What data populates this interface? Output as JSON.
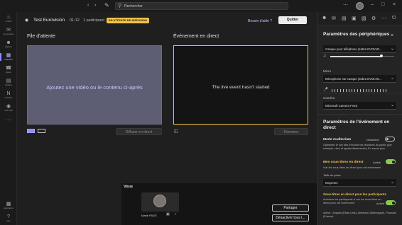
{
  "titlebar": {
    "search_placeholder": "Rechercher",
    "compose_icon": "compose-icon"
  },
  "rail": {
    "items": [
      {
        "label": "Activité",
        "icon": "bell-icon"
      },
      {
        "label": "Conversation",
        "icon": "chat-icon"
      },
      {
        "label": "Équipes",
        "icon": "teams-icon"
      },
      {
        "label": "Calendrier",
        "icon": "calendar-icon"
      },
      {
        "label": "Appels",
        "icon": "phone-icon"
      },
      {
        "label": "Fichiers",
        "icon": "file-icon"
      },
      {
        "label": "OneNote",
        "icon": "onenote-icon"
      },
      {
        "label": "Visit CRM",
        "icon": "crm-icon"
      },
      {
        "label": "Applications",
        "icon": "apps-icon"
      },
      {
        "label": "Aide",
        "icon": "help-icon"
      }
    ],
    "active_index": 3
  },
  "header": {
    "title": "Test Eurovision",
    "elapsed": "01:12",
    "participants": "1 participant",
    "badge": "EN ATTENTE DE DIFFUSION",
    "help_link": "Besoin d'aide ?",
    "quit_label": "Quitter"
  },
  "queue": {
    "title": "File d'attente",
    "message": "Ajoutez une vidéo ou le contenu ci-après",
    "button": "Diffuser en direct"
  },
  "live": {
    "title": "Événement en direct",
    "message": "The live event hasn't started",
    "button": "Démarrer"
  },
  "you": {
    "title": "Vous",
    "name": "Marie PAGE",
    "share": "Partager",
    "disable": "Désactiver tous l..."
  },
  "panel": {
    "title": "Paramètres des périphériques",
    "speaker": "Casque pour téléphone (Jabra EVOLVE...",
    "volume": 0.8,
    "mic_label": "Micro",
    "mic": "Microphone sur casque (Jabra EVOLVE...",
    "camera_label": "Caméra",
    "camera": "Microsoft Camera Front",
    "event_title": "Paramètres de l'événement en direct",
    "auditorium_title": "Mode Auditorium",
    "auditorium_state": "Désactivé",
    "auditorium_desc": "Optimisez le son afin d'inclure les réactions du public (par exemple, rires et applaudissements). En savoir plus",
    "subs_title": "Mes sous-titres en direct",
    "subs_state": "Activé",
    "subs_desc": "Voir les sous-titres en direct pour cet événement",
    "font_label": "Taille de police",
    "font_value": "Moyenne",
    "psubs_title": "Sous-titres en direct pour les participants",
    "psubs_state": "Activé",
    "psubs_desc": "Autoriser les participants à voir les sous-titres en direct pour cet événement",
    "psubs_langs": "Activé : Anglais (États-Unis), Allemand (Allemagne), Français (France)"
  },
  "colors": {
    "accent": "#8b8bff",
    "badge": "#f3c34a",
    "toggle_on": "#8acb4f"
  }
}
